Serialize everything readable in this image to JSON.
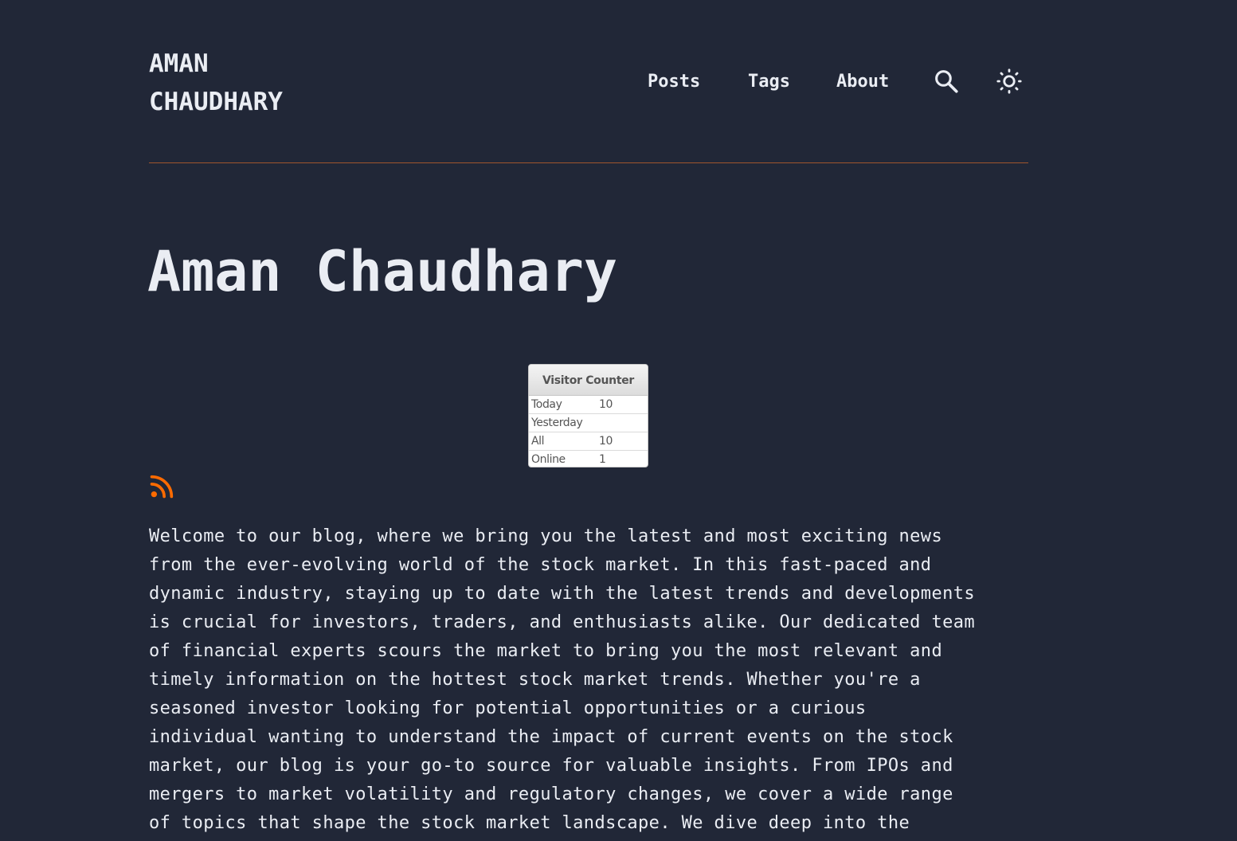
{
  "header": {
    "site_title_line1": "AMAN",
    "site_title_line2": "CHAUDHARY",
    "nav": {
      "posts": "Posts",
      "tags": "Tags",
      "about": "About"
    },
    "icons": {
      "search": "search-icon",
      "theme": "sun-icon"
    }
  },
  "hero": {
    "title": "Aman Chaudhary"
  },
  "visitor_counter": {
    "title": "Visitor Counter",
    "rows": [
      {
        "label": "Today",
        "value": "10"
      },
      {
        "label": "Yesterday",
        "value": ""
      },
      {
        "label": "All",
        "value": "10"
      },
      {
        "label": "Online",
        "value": "1"
      }
    ]
  },
  "rss": {
    "icon": "rss-icon",
    "color": "#ff6b01"
  },
  "intro": {
    "lines": [
      "Welcome to our blog, where we bring you the latest and most exciting news",
      "from the ever-evolving world of the stock market. In this fast-paced and",
      "dynamic industry, staying up to date with the latest trends and developments",
      "is crucial for investors, traders, and enthusiasts alike. Our dedicated team",
      "of financial experts scours the market to bring you the most relevant and",
      "timely information on the hottest stock market trends. Whether you're a",
      "seasoned investor looking for potential opportunities or a curious",
      "individual wanting to understand the impact of current events on the stock",
      "market, our blog is your go-to source for valuable insights. From IPOs and",
      "mergers to market volatility and regulatory changes, we cover a wide range",
      "of topics that shape the stock market landscape. We dive deep into the"
    ]
  },
  "colors": {
    "background": "#212737",
    "text": "#eaedf3",
    "accent": "#ff6b01",
    "divider": "#a0562d"
  }
}
